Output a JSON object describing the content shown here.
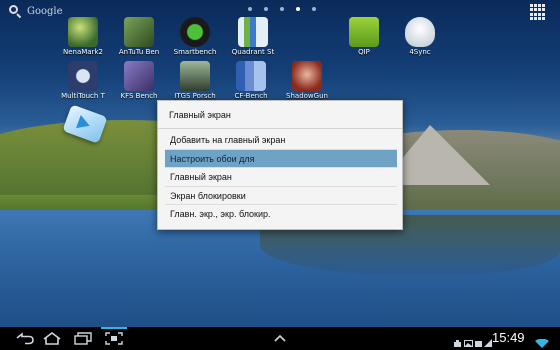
{
  "topbar": {
    "search_label": "Google",
    "page_dots": 5,
    "active_dot": 3
  },
  "desktop": {
    "icons": [
      {
        "label": "NenaMark2",
        "color": "#3a6a2d",
        "icon": "nenamark-icon"
      },
      {
        "label": "AnTuTu Ben",
        "color": "#3d5d2a",
        "icon": "antutu-icon"
      },
      {
        "label": "Smartbench",
        "color": "#1a1a1a",
        "icon": "smartbench-icon"
      },
      {
        "label": "Quadrant St",
        "color": "#b8c9d8",
        "icon": "quadrant-icon"
      },
      {
        "label": "QIP",
        "color": "#7fbf2b",
        "icon": "qip-icon"
      },
      {
        "label": "4Sync",
        "color": "#dfe6ee",
        "icon": "4sync-icon"
      },
      {
        "label": "MultiTouch T",
        "color": "#2c3c6b",
        "icon": "multitouch-icon"
      },
      {
        "label": "KFS Bench",
        "color": "#5a4b86",
        "icon": "kfs-icon"
      },
      {
        "label": "ITGS Porsch",
        "color": "#3a4f3a",
        "icon": "itgs-icon"
      },
      {
        "label": "CF-Bench",
        "color": "#6b8bd1",
        "icon": "cfbench-icon"
      },
      {
        "label": "ShadowGun",
        "color": "#8c2a1e",
        "icon": "shadowgun-icon"
      }
    ]
  },
  "dialog": {
    "title": "Главный экран",
    "options": [
      "Добавить на главный экран",
      "Настроить обои для",
      "Главный экран",
      "Экран блокировки",
      "Главн. экр., экр. блокир."
    ],
    "selected_index": 1
  },
  "navbar": {
    "time": "15:49"
  }
}
